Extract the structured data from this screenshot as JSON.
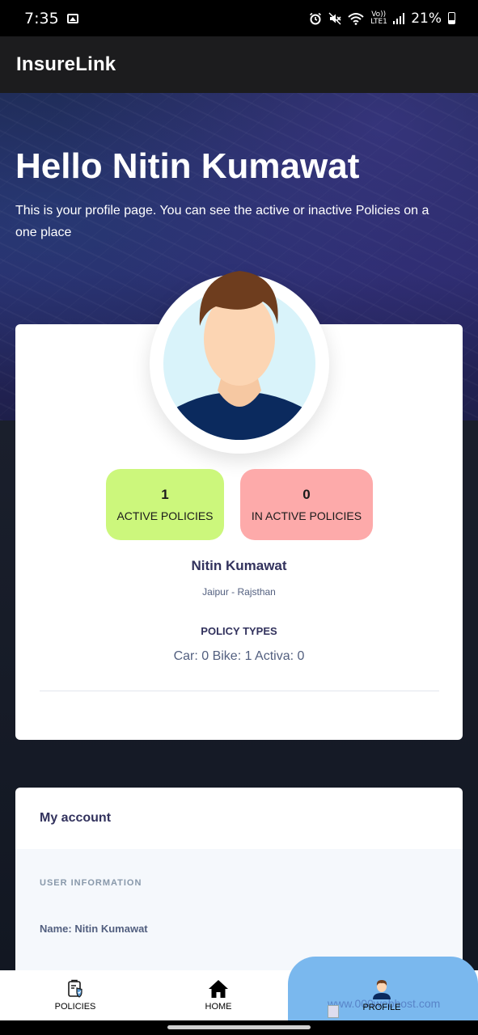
{
  "status_bar": {
    "time": "7:35",
    "battery": "21%",
    "network_label": "Vo)) LTE1",
    "icons": [
      "gallery-icon",
      "alarm-icon",
      "mute-icon",
      "wifi-icon",
      "signal-icon",
      "battery-icon"
    ]
  },
  "app_bar": {
    "title": "InsureLink"
  },
  "hero": {
    "title": "Hello Nitin Kumawat",
    "subtitle": "This is your profile page. You can see the active or inactive Policies on a one place"
  },
  "profile": {
    "stats": {
      "active": {
        "count": "1",
        "label": "ACTIVE POLICIES",
        "color": "#ccf77c"
      },
      "inactive": {
        "count": "0",
        "label": "IN ACTIVE POLICIES",
        "color": "#fdaaaa"
      }
    },
    "name": "Nitin Kumawat",
    "location": "Jaipur - Rajsthan",
    "policy_types_heading": "POLICY TYPES",
    "policy_types_values": "Car: 0 Bike: 1 Activa: 0"
  },
  "account": {
    "title": "My account",
    "section_heading": "USER INFORMATION",
    "name_line": "Name: Nitin Kumawat"
  },
  "bottom_nav": {
    "items": [
      {
        "label": "POLICIES",
        "icon": "policy-shield-icon"
      },
      {
        "label": "HOME",
        "icon": "home-icon"
      },
      {
        "label": "PROFILE",
        "icon": "user-avatar-icon",
        "active": true
      }
    ],
    "active_color": "#7ab8ee",
    "watermark": "www.000webhost.com"
  }
}
